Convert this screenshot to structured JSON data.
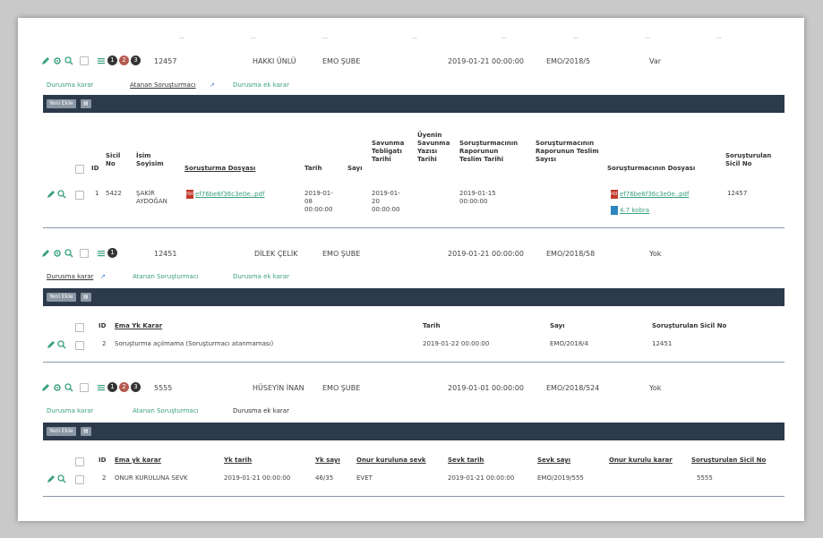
{
  "top_cut_headers": [
    "...",
    "...",
    "...",
    "...",
    "...",
    "...",
    "...",
    "..."
  ],
  "group1": {
    "badges": [
      "1",
      "2",
      "3"
    ],
    "sicil": "12457",
    "name": "HAKKI ÜNLÜ",
    "sube": "EMO ŞUBE",
    "date": "2019-01-21 00:00:00",
    "ref": "EMO/2018/5",
    "status": "Var",
    "links": [
      "Durusma karar",
      "Atanan Soruşturmacı",
      "Durusma ek karar"
    ]
  },
  "bar_buttons": {
    "new": "Yeni Ekle",
    "icon": "▤"
  },
  "table1": {
    "headers": [
      "ID",
      "Sicil No",
      "İsim Soyisim",
      "Soruşturma Dosyası",
      "Tarih",
      "Sayı",
      "Savunma Tebligatı Tarihi",
      "Üyenin Savunma Yazısı Tarihi",
      "Soruşturmacının Raporunun Teslim Tarihi",
      "Soruşturmacının Raporunun Teslim Sayısı",
      "Soruşturmacının Dosyası",
      "Soruşturulan Sicil No"
    ],
    "row": {
      "id": "1",
      "sicil": "5422",
      "name": "ŞAKİR AYDOĞAN",
      "file": "ef76be6f36c3e0e..pdf",
      "date": "2019-01-08 00:00:00",
      "savunma": "2019-01-20 00:00:00",
      "teslim": "2019-01-15 00:00:00",
      "dosya1": "ef76be6f36c3e0e..pdf",
      "dosya2": "4.7 kobra",
      "sicil_sorusturulan": "12457"
    }
  },
  "group2": {
    "badges": [
      "1"
    ],
    "sicil": "12451",
    "name": "DİLEK ÇELİK",
    "sube": "EMO ŞUBE",
    "date": "2019-01-21 00:00:00",
    "ref": "EMO/2018/58",
    "status": "Yok",
    "links": [
      "Durusma karar",
      "Atanan Soruşturmacı",
      "Durusma ek karar"
    ]
  },
  "table2": {
    "headers": [
      "ID",
      "Ema Yk Karar",
      "Tarih",
      "Sayı",
      "Soruşturulan Sicil No"
    ],
    "row": {
      "id": "2",
      "karar": "Soruşturma açılmama (Soruşturmacı atanmaması)",
      "date": "2019-01-22 00:00:00",
      "sayi": "EMO/2018/4",
      "sicil": "12451"
    }
  },
  "group3": {
    "badges": [
      "1",
      "2",
      "3"
    ],
    "sicil": "5555",
    "name": "HÜSEYİN İNAN",
    "sube": "EMO ŞUBE",
    "date": "2019-01-01 00:00:00",
    "ref": "EMO/2018/524",
    "status": "Yok",
    "links": [
      "Durusma karar",
      "Atanan Soruşturmacı",
      "Durusma ek karar"
    ]
  },
  "table3": {
    "headers": [
      "ID",
      "Ema yk karar",
      "Yk tarih",
      "Yk sayı",
      "Onur kuruluna sevk",
      "Sevk tarih",
      "Sevk sayı",
      "Onur kurulu karar",
      "Soruşturulan Sicil No"
    ],
    "row": {
      "id": "2",
      "karar": "ONUR KURULUNA SEVK",
      "yk_tarih": "2019-01-21 00:00:00",
      "yk_sayi": "46/35",
      "sevk": "EVET",
      "sevk_tarih": "2019-01-21 00:00:00",
      "sevk_sayi": "EMO/2019/555",
      "onur": "",
      "sicil": "5555"
    }
  },
  "colors": {
    "accent_green": "#3aa07a",
    "bar": "#2c3a4b",
    "badge_red": "#b35a4f",
    "pdf_red": "#c0392b",
    "doc_blue": "#2e86c1"
  },
  "icons": {
    "edit": "pencil-icon",
    "view": "eye-icon",
    "search": "search-icon",
    "list": "list-icon"
  }
}
